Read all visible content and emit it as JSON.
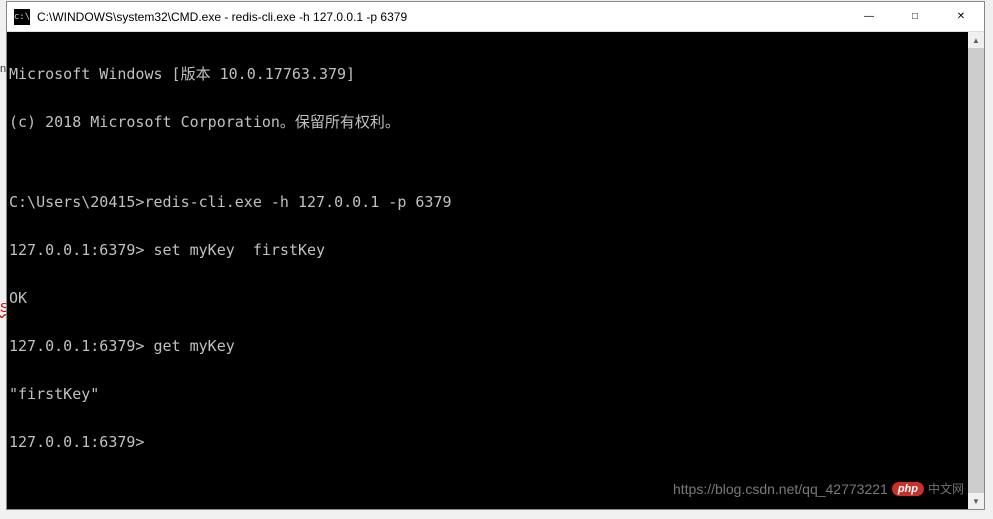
{
  "window": {
    "icon_text": "c:\\",
    "title": "C:\\WINDOWS\\system32\\CMD.exe - redis-cli.exe  -h 127.0.0.1 -p 6379",
    "controls": {
      "minimize": "—",
      "maximize": "□",
      "close": "✕"
    }
  },
  "terminal": {
    "lines": [
      "Microsoft Windows [版本 10.0.17763.379]",
      "(c) 2018 Microsoft Corporation。保留所有权利。",
      "",
      "C:\\Users\\20415>redis-cli.exe -h 127.0.0.1 -p 6379",
      "127.0.0.1:6379> set myKey  firstKey",
      "OK",
      "127.0.0.1:6379> get myKey",
      "\"firstKey\"",
      "127.0.0.1:6379>"
    ]
  },
  "scrollbar": {
    "up": "▲",
    "down": "▼"
  },
  "watermark": {
    "url": "https://blog.csdn.net/qq_42773221",
    "badge": "php",
    "cn": "中文网"
  },
  "edge": {
    "s": "S",
    "n": "n"
  }
}
